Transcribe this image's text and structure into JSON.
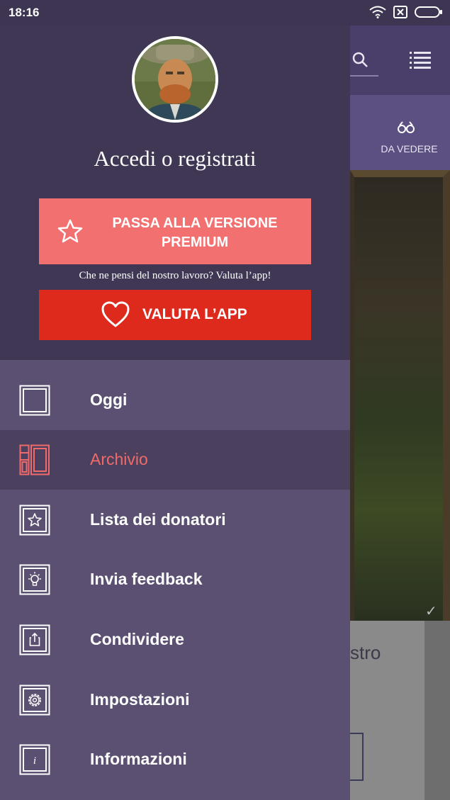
{
  "status_bar": {
    "time": "18:16",
    "icons": [
      "wifi-icon",
      "sim-icon",
      "battery-icon"
    ]
  },
  "background_app": {
    "tab_label": "DA VEDERE",
    "card_text": "stro"
  },
  "drawer": {
    "login_text": "Accedi o registrati",
    "premium_button": "PASSA ALLA VERSIONE PREMIUM",
    "rate_question": "Che ne pensi del nostro lavoro? Valuta l’app!",
    "rate_button": "VALUTA L’APP",
    "menu": [
      {
        "label": "Oggi",
        "icon": "square-icon",
        "active": false
      },
      {
        "label": "Archivio",
        "icon": "archive-icon",
        "active": true
      },
      {
        "label": "Lista dei donatori",
        "icon": "star-icon",
        "active": false
      },
      {
        "label": "Invia feedback",
        "icon": "lightbulb-icon",
        "active": false
      },
      {
        "label": "Condividere",
        "icon": "share-icon",
        "active": false
      },
      {
        "label": "Impostazioni",
        "icon": "gear-icon",
        "active": false
      },
      {
        "label": "Informazioni",
        "icon": "info-icon",
        "active": false
      }
    ]
  },
  "colors": {
    "drawer_header": "#3f3754",
    "drawer_menu": "#5b5071",
    "premium": "#f37070",
    "rate": "#dd2a1d",
    "active_label": "#f06a6a"
  }
}
